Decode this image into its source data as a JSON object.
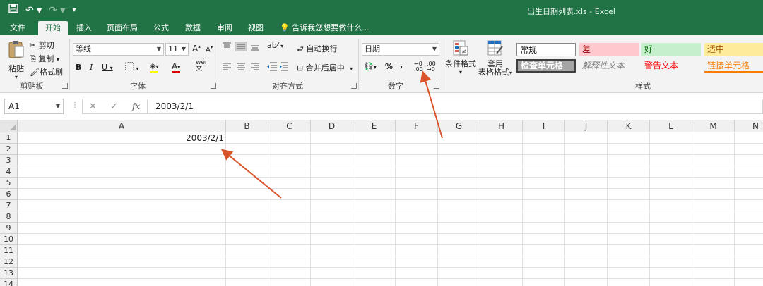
{
  "window": {
    "title": "出生日期列表.xls - Excel"
  },
  "tabs": [
    "文件",
    "开始",
    "插入",
    "页面布局",
    "公式",
    "数据",
    "审阅",
    "视图"
  ],
  "active_tab": "开始",
  "tell_me": "告诉我您想要做什么...",
  "clipboard": {
    "paste": "粘贴",
    "cut": "剪切",
    "copy": "复制",
    "format_painter": "格式刷",
    "label": "剪贴板"
  },
  "font": {
    "name": "等线",
    "size": "11",
    "bold": "B",
    "italic": "I",
    "underline": "U",
    "grow": "A",
    "shrink": "A",
    "label": "字体"
  },
  "alignment": {
    "wrap_text": "自动换行",
    "merge_center": "合并后居中",
    "label": "对齐方式"
  },
  "number": {
    "format": "日期",
    "percent": "%",
    "comma": ",",
    "label": "数字"
  },
  "styles": {
    "conditional_formatting": "条件格式",
    "format_as_table_1": "套用",
    "format_as_table_2": "表格格式",
    "cells": [
      {
        "text": "常规",
        "bg": "#ffffff",
        "color": "#000000"
      },
      {
        "text": "差",
        "bg": "#ffc7ce",
        "color": "#9c0006"
      },
      {
        "text": "好",
        "bg": "#c6efce",
        "color": "#006100"
      },
      {
        "text": "适中",
        "bg": "#ffeb9c",
        "color": "#9c5700"
      },
      {
        "text": "检查单元格",
        "bg": "#a5a5a5",
        "color": "#ffffff"
      },
      {
        "text": "解释性文本",
        "bg": "#f3f3f3",
        "color": "#7f7f7f"
      },
      {
        "text": "警告文本",
        "bg": "#f3f3f3",
        "color": "#ff0000"
      },
      {
        "text": "链接单元格",
        "bg": "#f3f3f3",
        "color": "#fa7d00"
      }
    ],
    "label": "样式"
  },
  "formula_bar": {
    "name_box": "A1",
    "cancel": "✕",
    "enter": "✓",
    "fx": "fx",
    "value": "2003/2/1"
  },
  "sheet": {
    "columns": [
      "A",
      "B",
      "C",
      "D",
      "E",
      "F",
      "G",
      "H",
      "I",
      "J",
      "K",
      "L",
      "M",
      "N"
    ],
    "rows": [
      "1",
      "2",
      "3",
      "4",
      "5",
      "6",
      "7",
      "8",
      "9",
      "10",
      "11",
      "12",
      "13",
      "14"
    ],
    "cell_A1": "2003/2/1"
  },
  "colors": {
    "accent": "#217346",
    "annotation": "#d9532b"
  }
}
